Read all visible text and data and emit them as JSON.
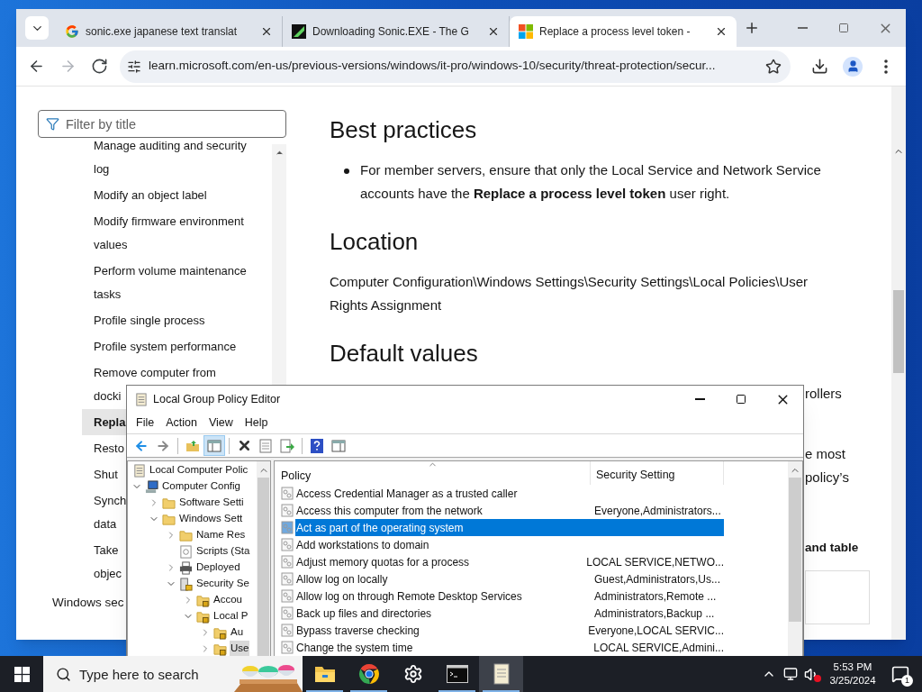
{
  "browser": {
    "tabs": [
      {
        "title": "sonic.exe japanese text translat",
        "selected": false
      },
      {
        "title": "Downloading Sonic.EXE - The G",
        "selected": false
      },
      {
        "title": "Replace a process level token -",
        "selected": true
      }
    ],
    "nav_buttons": [
      {
        "kind": "back",
        "disabled": false
      },
      {
        "kind": "forward",
        "disabled": true
      },
      {
        "kind": "reload",
        "disabled": false
      }
    ],
    "url": "learn.microsoft.com/en-us/previous-versions/windows/it-pro/windows-10/security/threat-protection/secur..."
  },
  "sidebar": {
    "filter_placeholder": "Filter by title",
    "items": [
      {
        "lines": [
          "Manage auditing and security",
          "log"
        ],
        "selected": false
      },
      {
        "lines": [
          "Modify an object label"
        ],
        "selected": false
      },
      {
        "lines": [
          "Modify firmware environment",
          "values"
        ],
        "selected": false
      },
      {
        "lines": [
          "Perform volume maintenance",
          "tasks"
        ],
        "selected": false
      },
      {
        "lines": [
          "Profile single process"
        ],
        "selected": false
      },
      {
        "lines": [
          "Profile system performance"
        ],
        "selected": false
      },
      {
        "lines": [
          "Remove computer from",
          "docki"
        ],
        "selected": false
      },
      {
        "lines": [
          "Repla"
        ],
        "selected": true
      },
      {
        "lines": [
          "Resto"
        ],
        "selected": false
      },
      {
        "lines": [
          "Shut"
        ],
        "selected": false
      },
      {
        "lines": [
          "Synch",
          "data"
        ],
        "selected": false
      },
      {
        "lines": [
          "Take",
          "objec"
        ],
        "selected": false
      }
    ],
    "section_link": "Windows sec"
  },
  "article": {
    "sections": [
      {
        "heading": "Best practices",
        "bullets": [
          "For member servers, ensure that only the Local Service and Network Service accounts have the **Replace a process level token** user right."
        ]
      },
      {
        "heading": "Location",
        "paragraph": "Computer Configuration\\Windows Settings\\Security Settings\\Local Policies\\User Rights Assignment"
      },
      {
        "heading": "Default values"
      }
    ],
    "fragments": [
      {
        "text": "rollers",
        "kind": "plain"
      },
      {
        "text": "e most",
        "kind": "plain"
      },
      {
        "text": "policy’s",
        "kind": "plain"
      },
      {
        "text": "and table",
        "kind": "bold"
      }
    ]
  },
  "gpedit": {
    "title": "Local Group Policy Editor",
    "menu": [
      "File",
      "Action",
      "View",
      "Help"
    ],
    "toolbar": [
      [
        {
          "kind": "back",
          "pressed": false
        },
        {
          "kind": "forward",
          "pressed": false
        }
      ],
      [
        {
          "kind": "up",
          "pressed": false
        },
        {
          "kind": "show-tree",
          "pressed": true
        }
      ],
      [
        {
          "kind": "delete",
          "pressed": false
        },
        {
          "kind": "properties",
          "pressed": false
        },
        {
          "kind": "export",
          "pressed": false
        }
      ],
      [
        {
          "kind": "help",
          "pressed": false
        },
        {
          "kind": "view",
          "pressed": false
        }
      ]
    ],
    "tree": {
      "label": "Local Computer Polic",
      "kind": "document",
      "selected": false,
      "children": [
        {
          "label": "Computer Config",
          "kind": "computer",
          "expanded": true,
          "selected": false,
          "children": [
            {
              "label": "Software Setti",
              "kind": "folder",
              "expanded": false,
              "selected": false
            },
            {
              "label": "Windows Sett",
              "kind": "folder",
              "expanded": true,
              "selected": false,
              "children": [
                {
                  "label": "Name Res",
                  "kind": "folder",
                  "expanded": false,
                  "selected": false
                },
                {
                  "label": "Scripts (Sta",
                  "kind": "script",
                  "selected": false
                },
                {
                  "label": "Deployed",
                  "kind": "printer",
                  "expanded": false,
                  "selected": false
                },
                {
                  "label": "Security Se",
                  "kind": "security",
                  "expanded": true,
                  "selected": false,
                  "children": [
                    {
                      "label": "Accou",
                      "kind": "locked-folder",
                      "expanded": false,
                      "selected": false
                    },
                    {
                      "label": "Local P",
                      "kind": "locked-folder",
                      "expanded": true,
                      "selected": false,
                      "children": [
                        {
                          "label": "Au",
                          "kind": "locked-folder",
                          "expanded": false,
                          "selected": false
                        },
                        {
                          "label": "Use",
                          "kind": "locked-folder",
                          "expanded": false,
                          "selected": true
                        }
                      ]
                    }
                  ]
                }
              ]
            }
          ]
        }
      ]
    },
    "columns": [
      "Policy",
      "Security Setting"
    ],
    "rows": [
      {
        "policy": "Access Credential Manager as a trusted caller",
        "selected": false
      },
      {
        "policy": "Access this computer from the network",
        "setting": "Everyone,Administrators...",
        "selected": false
      },
      {
        "policy": "Act as part of the operating system",
        "selected": true
      },
      {
        "policy": "Add workstations to domain",
        "selected": false
      },
      {
        "policy": "Adjust memory quotas for a process",
        "setting": "LOCAL SERVICE,NETWO...",
        "selected": false
      },
      {
        "policy": "Allow log on locally",
        "setting": "Guest,Administrators,Us...",
        "selected": false
      },
      {
        "policy": "Allow log on through Remote Desktop Services",
        "setting": "Administrators,Remote ...",
        "selected": false
      },
      {
        "policy": "Back up files and directories",
        "setting": "Administrators,Backup ...",
        "selected": false
      },
      {
        "policy": "Bypass traverse checking",
        "setting": "Everyone,LOCAL SERVIC...",
        "selected": false
      },
      {
        "policy": "Change the system time",
        "setting": "LOCAL SERVICE,Admini...",
        "selected": false
      }
    ]
  },
  "taskbar": {
    "search_placeholder": "Type here to search",
    "apps": [
      {
        "kind": "folder",
        "running": true,
        "active": false
      },
      {
        "kind": "chrome",
        "running": true,
        "active": false
      },
      {
        "kind": "settings",
        "running": false,
        "active": false
      },
      {
        "kind": "terminal",
        "running": true,
        "active": false
      },
      {
        "kind": "notepad",
        "running": true,
        "active": true
      }
    ],
    "time": "5:53 PM",
    "date": "3/25/2024",
    "notifications": "1"
  }
}
